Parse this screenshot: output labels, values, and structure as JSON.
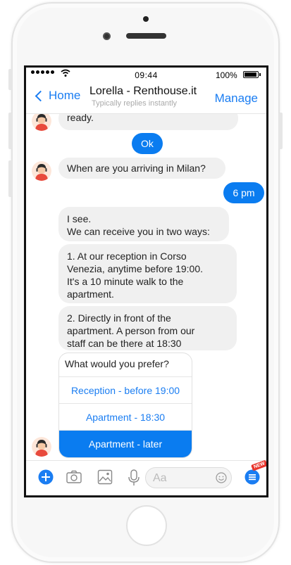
{
  "status": {
    "time": "09:44",
    "battery": "100%"
  },
  "nav": {
    "back_label": "Home",
    "title": "Lorella - Renthouse.it",
    "subtitle": "Typically replies instantly",
    "manage_label": "Manage"
  },
  "messages": [
    {
      "from": "bot",
      "text": "ready."
    },
    {
      "from": "user",
      "text": "Ok"
    },
    {
      "from": "bot",
      "text": "When are you arriving in Milan?"
    },
    {
      "from": "user",
      "text": "6 pm"
    },
    {
      "from": "bot",
      "text": "I see.\nWe can receive you in two ways:"
    },
    {
      "from": "bot",
      "text": "1. At our reception in Corso\nVenezia, anytime before 19:00.\nIt's a 10 minute walk to the\napartment."
    },
    {
      "from": "bot",
      "text": "2. Directly in front of the\napartment. A person from our\nstaff can be there at 18:30"
    }
  ],
  "quick_reply": {
    "question": "What would you prefer?",
    "options": [
      "Reception - before 19:00",
      "Apartment - 18:30",
      "Apartment - later"
    ],
    "selected_index": 2
  },
  "composer": {
    "placeholder": "Aa",
    "badge": "NEW"
  },
  "colors": {
    "accent": "#1a7df2",
    "user_bubble": "#0a7cf0",
    "bot_bubble": "#f0f0f0"
  }
}
